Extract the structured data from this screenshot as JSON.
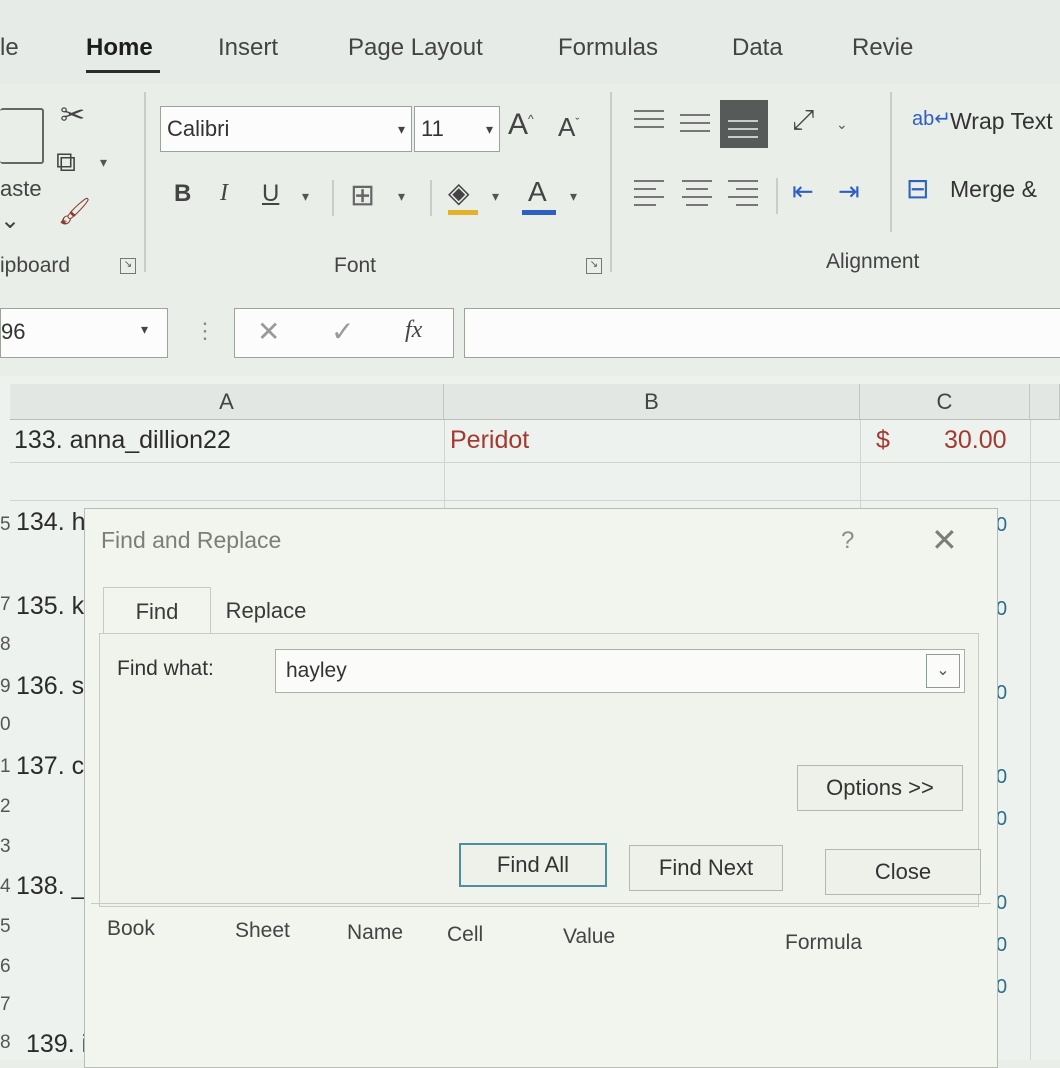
{
  "ribbon_tabs": [
    "le",
    "Home",
    "Insert",
    "Page Layout",
    "Formulas",
    "Data",
    "Revie"
  ],
  "clipboard": {
    "paste_label": "aste",
    "group_label": "ipboard"
  },
  "font": {
    "name": "Calibri",
    "size": "11",
    "group_label": "Font",
    "bold": "B",
    "italic": "I",
    "underline": "U",
    "grow": "A",
    "shrink": "A",
    "color_a": "A"
  },
  "alignment": {
    "wrap_text": "Wrap Text",
    "merge": "Merge &",
    "group_label": "Alignment"
  },
  "formula_bar": {
    "name_box": "96",
    "fx": "fx"
  },
  "columns": [
    "A",
    "B",
    "C"
  ],
  "rows": [
    {
      "a": "133. anna_dillion22",
      "b": "Peridot",
      "c_sym": "$",
      "c_val": "30.00"
    },
    {
      "a": "134. h",
      "c_tail": "0"
    },
    {
      "a": "135. k",
      "c_tail": "0"
    },
    {
      "a": "136. s",
      "c_tail": "0"
    },
    {
      "a": "137. c",
      "c_tail": "0"
    },
    {
      "a": "138. _",
      "c_tail": "0"
    },
    {
      "a": "139. ii"
    }
  ],
  "row_numbers": [
    "5",
    "7",
    "8",
    "9",
    "0",
    "1",
    "2",
    "3",
    "4",
    "5",
    "6",
    "7",
    "8"
  ],
  "c_tails": [
    "0",
    "0",
    "0",
    "0",
    "0",
    "0",
    "0",
    "0",
    "0"
  ],
  "dialog": {
    "title": "Find and Replace",
    "help": "?",
    "close_glyph": "✕",
    "tabs": [
      "Find",
      "Replace"
    ],
    "find_what_label": "Find what:",
    "find_what_value": "hayley",
    "options_button": "Options >>",
    "find_all_button": "Find All",
    "find_next_button": "Find Next",
    "close_button": "Close",
    "result_columns": [
      "Book",
      "Sheet",
      "Name",
      "Cell",
      "Value",
      "Formula"
    ]
  }
}
